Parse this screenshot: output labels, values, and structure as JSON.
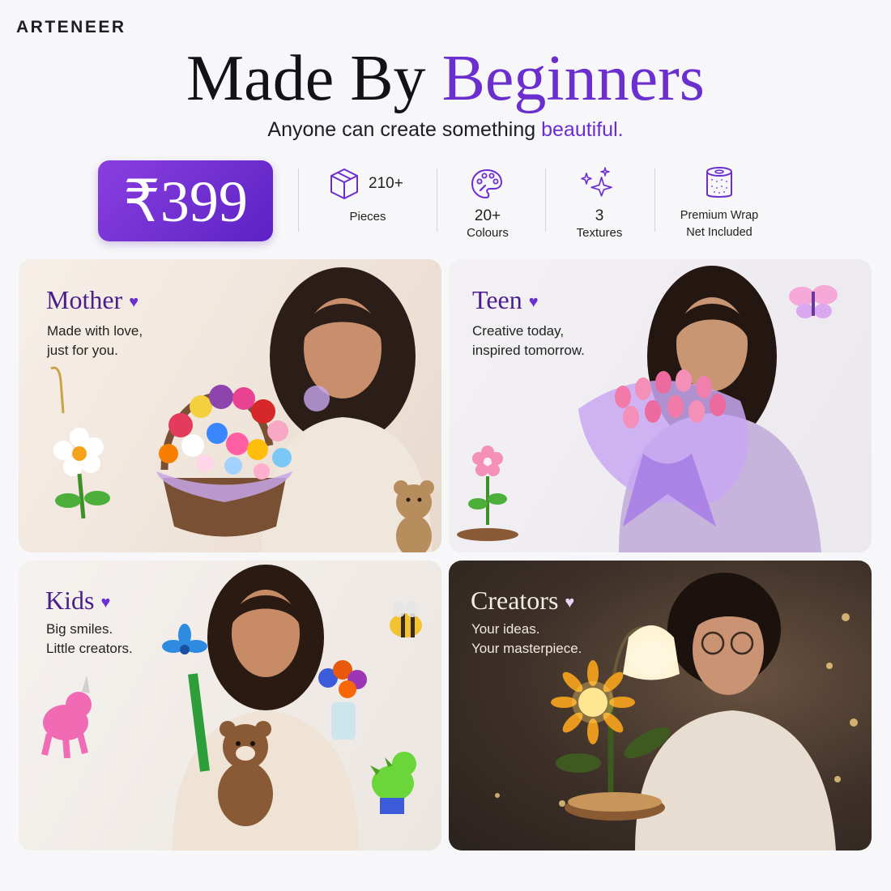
{
  "brand": "ARTENEER",
  "headline": {
    "part1": "Made By ",
    "part2": "Beginners"
  },
  "subheadline": {
    "part1": "Anyone can create something ",
    "part2": "beautiful."
  },
  "price": "₹399",
  "stats": [
    {
      "value": "210+",
      "label": "Pieces",
      "icon": "box-icon"
    },
    {
      "value": "20+",
      "label": "Colours",
      "icon": "palette-icon"
    },
    {
      "value": "3",
      "label": "Textures",
      "icon": "sparkle-icon"
    },
    {
      "value": "Premium Wrap",
      "label": "Net Included",
      "icon": "roll-icon"
    }
  ],
  "cards": {
    "mother": {
      "title": "Mother",
      "line1": "Made with love,",
      "line2": "just for you."
    },
    "teen": {
      "title": "Teen",
      "line1": "Creative today,",
      "line2": "inspired tomorrow."
    },
    "kids": {
      "title": "Kids",
      "line1": "Big smiles.",
      "line2": "Little creators."
    },
    "creators": {
      "title": "Creators",
      "line1": "Your ideas.",
      "line2": "Your masterpiece."
    }
  },
  "colors": {
    "accent": "#6b2fd0",
    "priceBg": "#7a35d8",
    "darkCard": "#3d3028"
  }
}
